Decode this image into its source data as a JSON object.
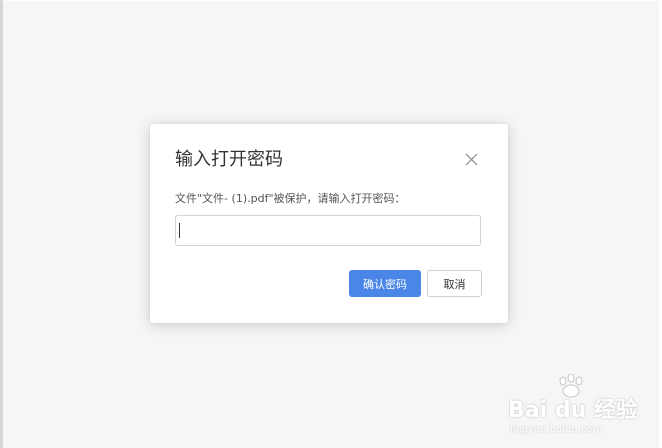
{
  "dialog": {
    "title": "输入打开密码",
    "message": "文件\"文件- (1).pdf\"被保护，请输入打开密码：",
    "password_value": "",
    "confirm_label": "确认密码",
    "cancel_label": "取消",
    "close_icon": "close-icon"
  },
  "watermark": {
    "logo_text": "Bai du 经验",
    "sub_text": "jingyan.baidu.com",
    "icon": "paw-icon"
  },
  "colors": {
    "background": "#f6f6f8",
    "dialog": "#ffffff",
    "primary": "#4a86e8",
    "title_text": "#333333",
    "body_text": "#555555",
    "border": "#d2d4d8"
  }
}
